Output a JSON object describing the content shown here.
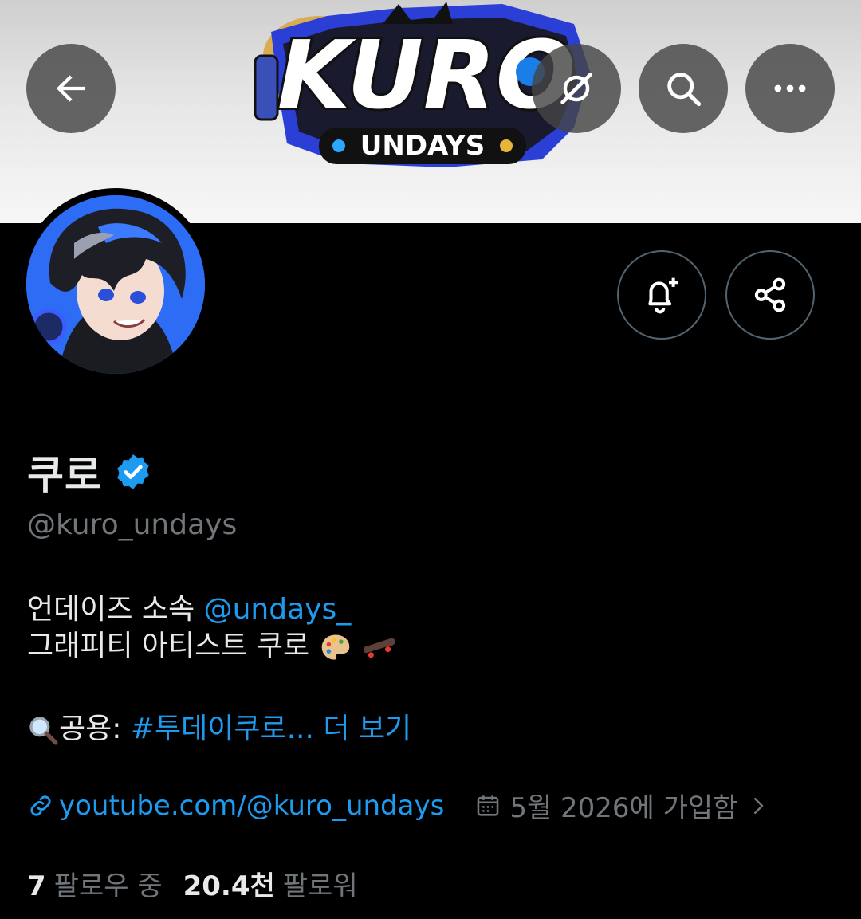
{
  "header": {
    "banner_logo_text": "KURO",
    "banner_logo_subtext": "UNDAYS",
    "buttons": [
      {
        "name": "back",
        "icon": "arrow-left-icon"
      },
      {
        "name": "grok",
        "icon": "grok-icon"
      },
      {
        "name": "search",
        "icon": "search-icon"
      },
      {
        "name": "more",
        "icon": "more-icon"
      }
    ]
  },
  "profile": {
    "display_name": "쿠로",
    "verified": true,
    "handle": "@kuro_undays",
    "bio": {
      "line1_text": "언데이즈 소속 ",
      "line1_mention": "@undays_",
      "line2_text": "그래피티 아티스트 쿠로",
      "line3_prefix": "공용: ",
      "line3_hashtag": "#투데이쿠로...",
      "line3_more": "더 보기"
    },
    "website": "youtube.com/@kuro_undays",
    "joined": "5월 2026에 가입함",
    "following_count": "7",
    "following_label": "팔로우 중",
    "followers_count": "20.4천",
    "followers_label": "팔로워"
  },
  "colors": {
    "accent": "#1d9bf0",
    "background": "#000000",
    "muted": "#71767b",
    "text": "#e7e9ea"
  }
}
